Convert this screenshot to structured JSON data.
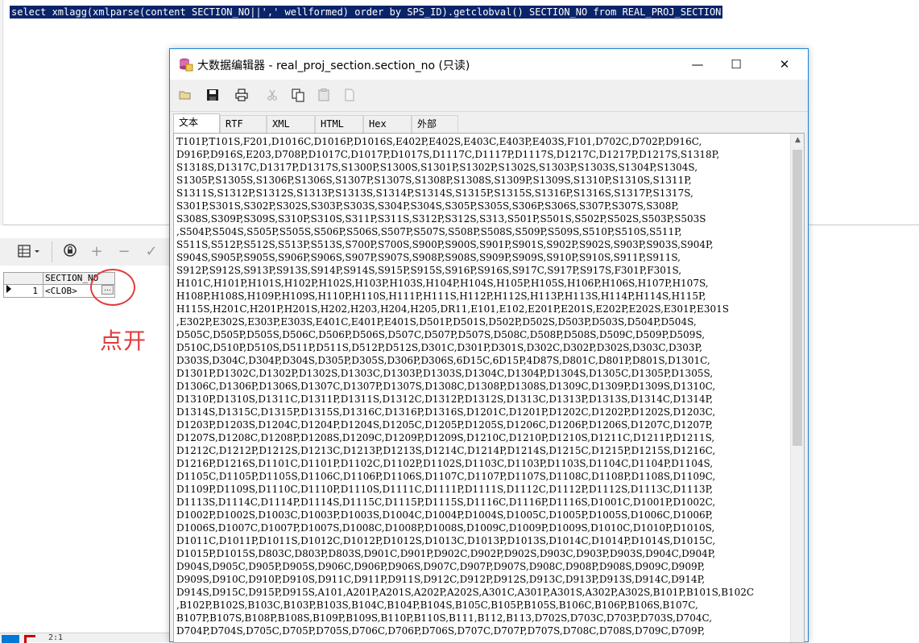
{
  "sql_editor": {
    "query": "select xmlagg(xmlparse(content SECTION_NO||',' wellformed) order by SPS_ID).getclobval() SECTION_NO from REAL_PROJ_SECTION"
  },
  "results_grid": {
    "toolbar": {
      "grid_icon": "grid-icon",
      "lock_icon": "lock-icon",
      "add": "+",
      "remove": "−",
      "post": "✓"
    },
    "column_header": "SECTION_NO",
    "row_number": "1",
    "cell_value": "<CLOB>",
    "ellipsis": "..."
  },
  "annotation": {
    "text": "点开",
    "color": "#e23b3b"
  },
  "status_bar": {
    "position": "2:1"
  },
  "dialog": {
    "title": "大数据编辑器 - real_proj_section.section_no (只读)",
    "window_buttons": {
      "minimize": "—",
      "maximize": "☐",
      "close": "✕"
    },
    "toolbar_icons": [
      "open-icon",
      "save-icon",
      "print-icon",
      "cut-icon",
      "copy-icon",
      "paste-icon",
      "clear-icon"
    ],
    "tabs": [
      "文本",
      "RTF",
      "XML",
      "HTML",
      "Hex",
      "外部"
    ],
    "active_tab": "文本",
    "text_lines": [
      "T101P,T101S,F201,D1016C,D1016P,D1016S,E402P,E402S,E403C,E403P,E403S,F101,D702C,D702P,D916C,",
      "D916P,D916S,E203,D708P,D1017C,D1017P,D1017S,D1117C,D1117P,D1117S,D1217C,D1217P,D1217S,S1318P,",
      "S1318S,D1317C,D1317P,D1317S,S1300P,S1300S,S1301P,S1302P,S1302S,S1303P,S1303S,S1304P,S1304S,",
      "S1305P,S1305S,S1306P,S1306S,S1307P,S1307S,S1308P,S1308S,S1309P,S1309S,S1310P,S1310S,S1311P,",
      "S1311S,S1312P,S1312S,S1313P,S1313S,S1314P,S1314S,S1315P,S1315S,S1316P,S1316S,S1317P,S1317S,",
      "S301P,S301S,S302P,S302S,S303P,S303S,S304P,S304S,S305P,S305S,S306P,S306S,S307P,S307S,S308P,",
      "S308S,S309P,S309S,S310P,S310S,S311P,S311S,S312P,S312S,S313,S501P,S501S,S502P,S502S,S503P,S503S",
      ",S504P,S504S,S505P,S505S,S506P,S506S,S507P,S507S,S508P,S508S,S509P,S509S,S510P,S510S,S511P,",
      "S511S,S512P,S512S,S513P,S513S,S700P,S700S,S900P,S900S,S901P,S901S,S902P,S902S,S903P,S903S,S904P,",
      "S904S,S905P,S905S,S906P,S906S,S907P,S907S,S908P,S908S,S909P,S909S,S910P,S910S,S911P,S911S,",
      "S912P,S912S,S913P,S913S,S914P,S914S,S915P,S915S,S916P,S916S,S917C,S917P,S917S,F301P,F301S,",
      "H101C,H101P,H101S,H102P,H102S,H103P,H103S,H104P,H104S,H105P,H105S,H106P,H106S,H107P,H107S,",
      "H108P,H108S,H109P,H109S,H110P,H110S,H111P,H111S,H112P,H112S,H113P,H113S,H114P,H114S,H115P,",
      "H115S,H201C,H201P,H201S,H202,H203,H204,H205,DR11,E101,E102,E201P,E201S,E202P,E202S,E301P,E301S",
      ",E302P,E302S,E303P,E303S,E401C,E401P,E401S,D501P,D501S,D502P,D502S,D503P,D503S,D504P,D504S,",
      "D505C,D505P,D505S,D506C,D506P,D506S,D507C,D507P,D507S,D508C,D508P,D508S,D509C,D509P,D509S,",
      "D510C,D510P,D510S,D511P,D511S,D512P,D512S,D301C,D301P,D301S,D302C,D302P,D302S,D303C,D303P,",
      "D303S,D304C,D304P,D304S,D305P,D305S,D306P,D306S,6D15C,6D15P,4D87S,D801C,D801P,D801S,D1301C,",
      "D1301P,D1302C,D1302P,D1302S,D1303C,D1303P,D1303S,D1304C,D1304P,D1304S,D1305C,D1305P,D1305S,",
      "D1306C,D1306P,D1306S,D1307C,D1307P,D1307S,D1308C,D1308P,D1308S,D1309C,D1309P,D1309S,D1310C,",
      "D1310P,D1310S,D1311C,D1311P,D1311S,D1312C,D1312P,D1312S,D1313C,D1313P,D1313S,D1314C,D1314P,",
      "D1314S,D1315C,D1315P,D1315S,D1316C,D1316P,D1316S,D1201C,D1201P,D1202C,D1202P,D1202S,D1203C,",
      "D1203P,D1203S,D1204C,D1204P,D1204S,D1205C,D1205P,D1205S,D1206C,D1206P,D1206S,D1207C,D1207P,",
      "D1207S,D1208C,D1208P,D1208S,D1209C,D1209P,D1209S,D1210C,D1210P,D1210S,D1211C,D1211P,D1211S,",
      "D1212C,D1212P,D1212S,D1213C,D1213P,D1213S,D1214C,D1214P,D1214S,D1215C,D1215P,D1215S,D1216C,",
      "D1216P,D1216S,D1101C,D1101P,D1102C,D1102P,D1102S,D1103C,D1103P,D1103S,D1104C,D1104P,D1104S,",
      "D1105C,D1105P,D1105S,D1106C,D1106P,D1106S,D1107C,D1107P,D1107S,D1108C,D1108P,D1108S,D1109C,",
      "D1109P,D1109S,D1110C,D1110P,D1110S,D1111C,D1111P,D1111S,D1112C,D1112P,D1112S,D1113C,D1113P,",
      "D1113S,D1114C,D1114P,D1114S,D1115C,D1115P,D1115S,D1116C,D1116P,D1116S,D1001C,D1001P,D1002C,",
      "D1002P,D1002S,D1003C,D1003P,D1003S,D1004C,D1004P,D1004S,D1005C,D1005P,D1005S,D1006C,D1006P,",
      "D1006S,D1007C,D1007P,D1007S,D1008C,D1008P,D1008S,D1009C,D1009P,D1009S,D1010C,D1010P,D1010S,",
      "D1011C,D1011P,D1011S,D1012C,D1012P,D1012S,D1013C,D1013P,D1013S,D1014C,D1014P,D1014S,D1015C,",
      "D1015P,D1015S,D803C,D803P,D803S,D901C,D901P,D902C,D902P,D902S,D903C,D903P,D903S,D904C,D904P,",
      "D904S,D905C,D905P,D905S,D906C,D906P,D906S,D907C,D907P,D907S,D908C,D908P,D908S,D909C,D909P,",
      "D909S,D910C,D910P,D910S,D911C,D911P,D911S,D912C,D912P,D912S,D913C,D913P,D913S,D914C,D914P,",
      "D914S,D915C,D915P,D915S,A101,A201P,A201S,A202P,A202S,A301C,A301P,A301S,A302P,A302S,B101P,B101S,B102C",
      ",B102P,B102S,B103C,B103P,B103S,B104C,B104P,B104S,B105C,B105P,B105S,B106C,B106P,B106S,B107C,",
      "B107P,B107S,B108P,B108S,B109P,B109S,B110P,B110S,B111,B112,B113,D702S,D703C,D703P,D703S,D704C,",
      "D704P,D704S,D705C,D705P,D705S,D706C,D706P,D706S,D707C,D707P,D707S,D708C,D708S,D709C,D709P,"
    ]
  }
}
